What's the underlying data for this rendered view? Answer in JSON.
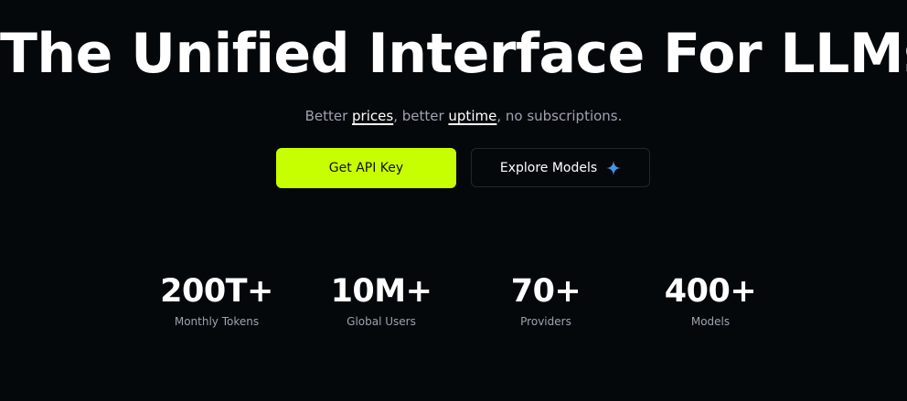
{
  "hero": {
    "title": "The Unified Interface For LLMs",
    "subtitle": {
      "part1": "Better ",
      "link1": "prices",
      "part2": ", better ",
      "link2": "uptime",
      "part3": ", no subscriptions."
    }
  },
  "buttons": {
    "primary_label": "Get API Key",
    "secondary_label": "Explore Models",
    "secondary_icon": "sparkle-icon"
  },
  "stats": [
    {
      "value": "200T+",
      "label": "Monthly Tokens"
    },
    {
      "value": "10M+",
      "label": "Global Users"
    },
    {
      "value": "70+",
      "label": "Providers"
    },
    {
      "value": "400+",
      "label": "Models"
    }
  ],
  "colors": {
    "background": "#05080b",
    "accent": "#c8ff00",
    "sparkle": "#4a90e2",
    "muted_text": "#9ca3af"
  }
}
